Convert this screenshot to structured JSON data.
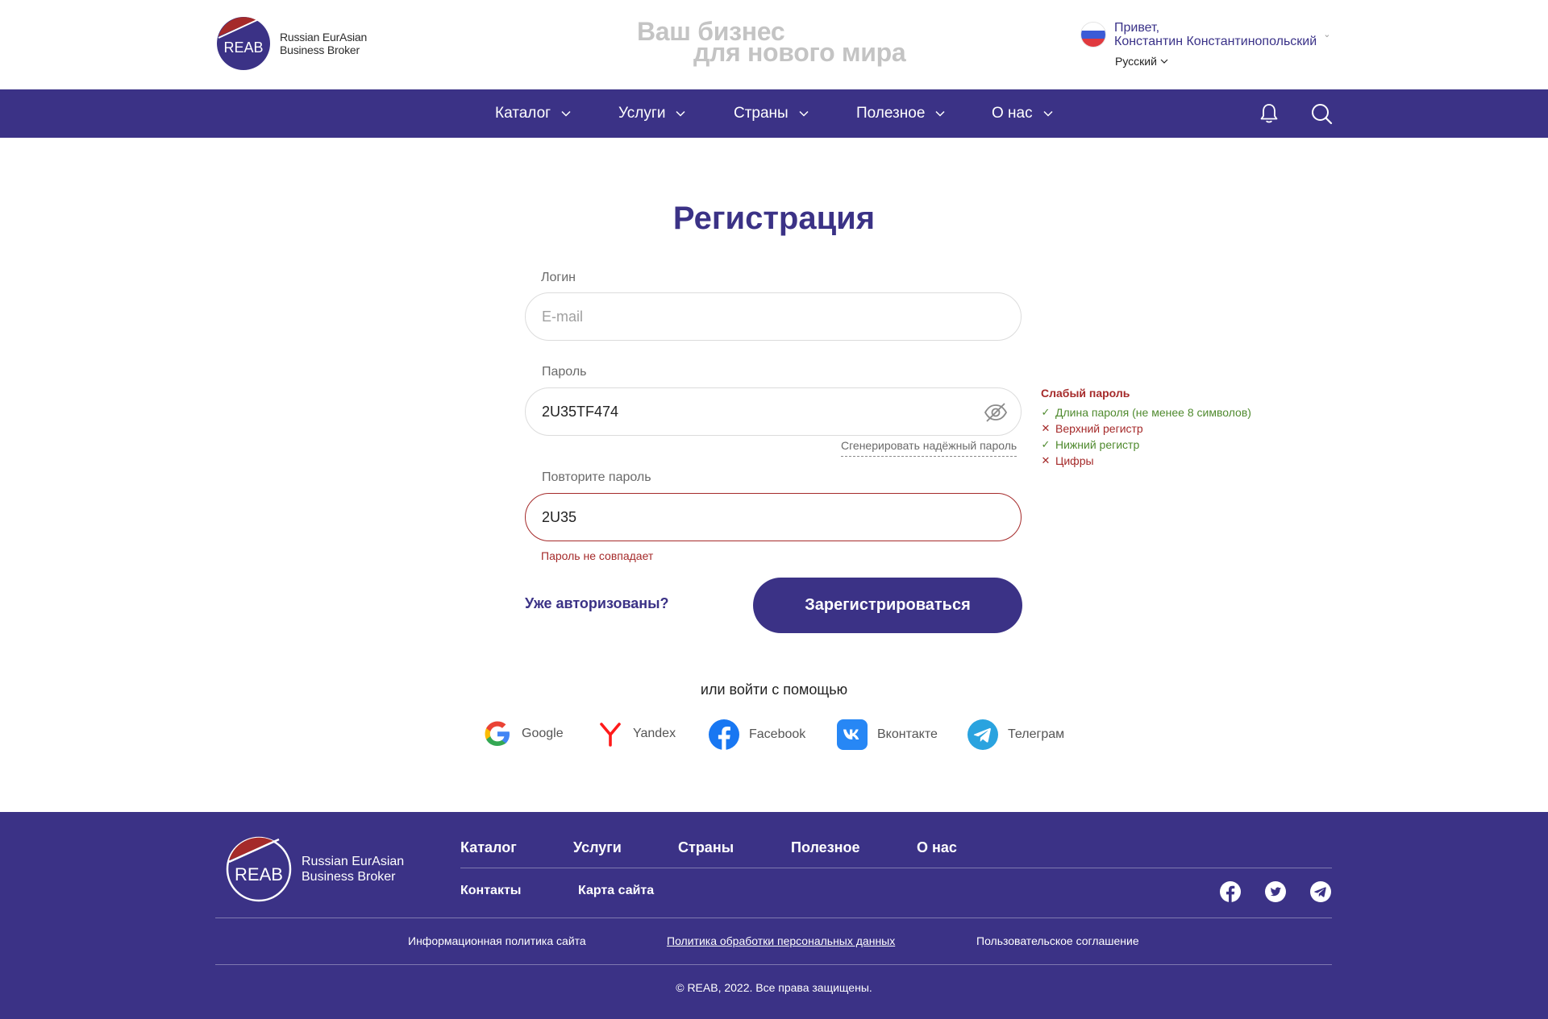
{
  "header": {
    "logo_mark": "REAB",
    "logo_line1": "Russian EurAsian",
    "logo_line2": "Business Broker",
    "slogan_line1": "Ваш бизнес",
    "slogan_line2": "для нового мира",
    "greeting_line1": "Привет,",
    "greeting_line2": "Константин Константинопольский",
    "language": "Русский"
  },
  "nav": {
    "items": [
      {
        "label": "Каталог"
      },
      {
        "label": "Услуги"
      },
      {
        "label": "Страны"
      },
      {
        "label": "Полезное"
      },
      {
        "label": "О нас"
      }
    ]
  },
  "form": {
    "title": "Регистрация",
    "login_label": "Логин",
    "login_placeholder": "E-mail",
    "password_label": "Пароль",
    "password_value": "2U35TF474",
    "generate_link": "Сгенерировать надёжный пароль",
    "repeat_label": "Повторите пароль",
    "repeat_value": "2U35",
    "mismatch_error": "Пароль не совпадает",
    "already_link": "Уже авторизованы?",
    "submit_label": "Зарегистрироваться",
    "or_text": "или войти с помощью"
  },
  "strength": {
    "title": "Слабый пароль",
    "criteria": [
      {
        "label": "Длина пароля (не менее 8 символов)",
        "ok": true,
        "mark": "✓"
      },
      {
        "label": "Верхний регистр",
        "ok": false,
        "mark": "✕"
      },
      {
        "label": "Нижний регистр",
        "ok": true,
        "mark": "✓"
      },
      {
        "label": "Цифры",
        "ok": false,
        "mark": "✕"
      }
    ]
  },
  "social": [
    {
      "label": "Google",
      "icon": "google-icon"
    },
    {
      "label": "Yandex",
      "icon": "yandex-icon"
    },
    {
      "label": "Facebook",
      "icon": "facebook-icon"
    },
    {
      "label": "Вконтакте",
      "icon": "vk-icon"
    },
    {
      "label": "Телеграм",
      "icon": "telegram-icon"
    }
  ],
  "footer": {
    "logo_mark": "REAB",
    "logo_line1": "Russian EurAsian",
    "logo_line2": "Business Broker",
    "nav": [
      "Каталог",
      "Услуги",
      "Страны",
      "Полезное",
      "О нас"
    ],
    "sub": [
      "Контакты",
      "Карта сайта"
    ],
    "links": [
      "Информационная политика сайта",
      "Политика обработки персональных данных",
      "Пользовательское соглашение"
    ],
    "copyright": "© REAB, 2022. Все права защищены."
  },
  "colors": {
    "brand": "#3b3286",
    "accent_red": "#a52a2a",
    "ok_green": "#4f8a2e"
  }
}
